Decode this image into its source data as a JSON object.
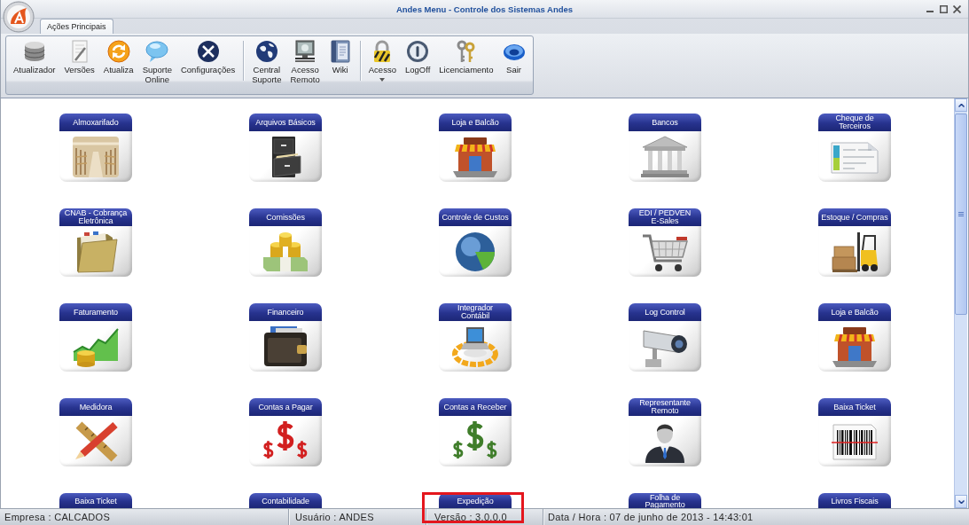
{
  "window": {
    "title": "Andes Menu - Controle dos Sistemas Andes"
  },
  "tabs": [
    {
      "label": "Ações Principais",
      "selected": true
    }
  ],
  "ribbon": {
    "groups": [
      {
        "buttons": [
          {
            "label": "Atualizador",
            "has_dropdown": false
          },
          {
            "label": "Versões",
            "has_dropdown": false
          },
          {
            "label": "Atualiza",
            "has_dropdown": false
          },
          {
            "label": "Suporte Online",
            "has_dropdown": false
          },
          {
            "label": "Configurações",
            "has_dropdown": false
          }
        ]
      },
      {
        "buttons": [
          {
            "label": "Central Suporte",
            "has_dropdown": false
          },
          {
            "label": "Acesso Remoto",
            "has_dropdown": false
          },
          {
            "label": "Wiki",
            "has_dropdown": false
          }
        ]
      },
      {
        "buttons": [
          {
            "label": "Acesso",
            "has_dropdown": true
          },
          {
            "label": "LogOff",
            "has_dropdown": false
          },
          {
            "label": "Licenciamento",
            "has_dropdown": false
          },
          {
            "label": "Sair",
            "has_dropdown": false
          }
        ]
      }
    ]
  },
  "modules": [
    {
      "label": "Almoxarifado",
      "kind": "full"
    },
    {
      "label": "Arquivos Básicos",
      "kind": "full"
    },
    {
      "label": "Loja e Balcão",
      "kind": "full"
    },
    {
      "label": "Bancos",
      "kind": "full"
    },
    {
      "label": "Cheque de\nTerceiros",
      "kind": "full"
    },
    {
      "label": "CNAB - Cobrança\nEletrônica",
      "kind": "full"
    },
    {
      "label": "Comissões",
      "kind": "full"
    },
    {
      "label": "Controle de Custos",
      "kind": "full"
    },
    {
      "label": "EDI / PEDVEN\nE-Sales",
      "kind": "full"
    },
    {
      "label": "Estoque / Compras",
      "kind": "full"
    },
    {
      "label": "Faturamento",
      "kind": "full"
    },
    {
      "label": "Financeiro",
      "kind": "full"
    },
    {
      "label": "Integrador\nContábil",
      "kind": "full"
    },
    {
      "label": "Log Control",
      "kind": "full"
    },
    {
      "label": "Loja e Balcão",
      "kind": "full"
    },
    {
      "label": "Medidora",
      "kind": "full"
    },
    {
      "label": "Contas a Pagar",
      "kind": "full"
    },
    {
      "label": "Contas a Receber",
      "kind": "full"
    },
    {
      "label": "Representante\nRemoto",
      "kind": "full"
    },
    {
      "label": "Baixa Ticket",
      "kind": "full"
    },
    {
      "label": "Baixa Ticket",
      "kind": "clipped"
    },
    {
      "label": "Contabilidade",
      "kind": "clipped"
    },
    {
      "label": "Expedição",
      "kind": "clipped"
    },
    {
      "label": "Folha de\nPagamento",
      "kind": "clipped"
    },
    {
      "label": "Livros Fiscais",
      "kind": "clipped"
    }
  ],
  "status_bar": {
    "fields": [
      {
        "text": "Empresa : CALCADOS",
        "highlighted": false
      },
      {
        "text": "Usuário : ANDES",
        "highlighted": false
      },
      {
        "text": "Versão : 3.0.0.0",
        "highlighted": true
      },
      {
        "text": "Data / Hora : 07 de junho de 2013 - 14:43:01",
        "highlighted": false
      }
    ]
  }
}
